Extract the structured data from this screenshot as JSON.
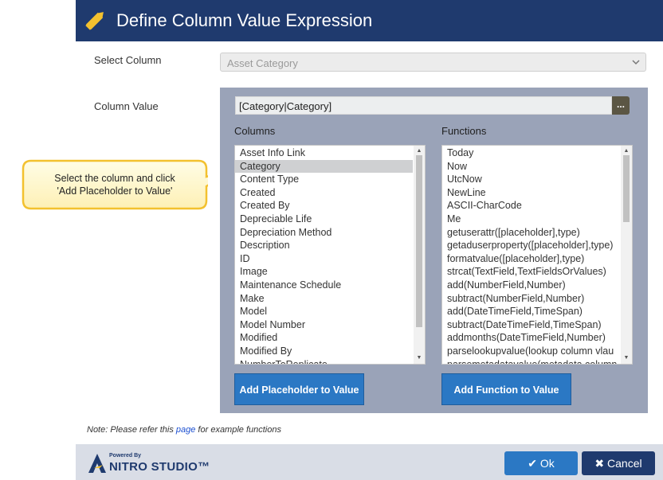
{
  "dialog": {
    "title": "Define Column Value Expression",
    "title_icon": "pencil-icon"
  },
  "select_column": {
    "label": "Select Column",
    "value": "Asset Category"
  },
  "column_value": {
    "label": "Column Value",
    "value": "[Category|Category]",
    "picker_label": "..."
  },
  "columns": {
    "heading": "Columns",
    "items": [
      "Asset Info Link",
      "Category",
      "Content Type",
      "Created",
      "Created By",
      "Depreciable Life",
      "Depreciation Method",
      "Description",
      "ID",
      "Image",
      "Maintenance Schedule",
      "Make",
      "Model",
      "Model Number",
      "Modified",
      "Modified By",
      "NumberToReplicate"
    ],
    "selected": "Category",
    "add_button": "Add Placeholder to Value"
  },
  "functions": {
    "heading": "Functions",
    "items": [
      "Today",
      "Now",
      "UtcNow",
      "NewLine",
      "ASCII-CharCode",
      "Me",
      "getuserattr([placeholder],type)",
      "getaduserproperty([placeholder],type)",
      "formatvalue([placeholder],type)",
      "strcat(TextField,TextFieldsOrValues)",
      "add(NumberField,Number)",
      "subtract(NumberField,Number)",
      "add(DateTimeField,TimeSpan)",
      "subtract(DateTimeField,TimeSpan)",
      "addmonths(DateTimeField,Number)",
      "parselookupvalue(lookup column vlau",
      "parsemetadatavalue(metadata column"
    ],
    "add_button": "Add Function to Value"
  },
  "callout": {
    "line1": "Select the column and click",
    "line2": "'Add Placeholder to Value'"
  },
  "note": {
    "prefix": "Note: Please refer this ",
    "link": "page",
    "suffix": " for example functions"
  },
  "footer": {
    "powered_by": "Powered By",
    "brand": "NITRO STUDIO™",
    "ok_label": "Ok",
    "cancel_label": "Cancel"
  },
  "colors": {
    "title_bar": "#1f3a6e",
    "panel": "#9aa3b8",
    "button_blue": "#2b78c4",
    "accent_yellow": "#f3c12f"
  }
}
